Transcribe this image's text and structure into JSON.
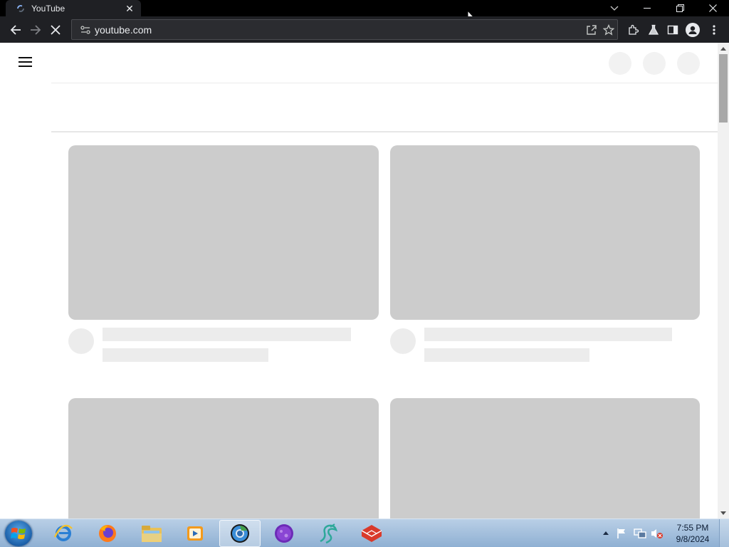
{
  "browser": {
    "tab": {
      "title": "YouTube",
      "favicon": "youtube-loading-icon",
      "close_icon": "close-icon"
    },
    "window_controls": [
      "tab-search-icon",
      "minimize-icon",
      "restore-icon",
      "close-icon"
    ],
    "toolbar": {
      "back_icon": "back-arrow-icon",
      "forward_icon": "forward-arrow-icon",
      "reload_icon": "stop-loading-icon",
      "address": "youtube.com",
      "site_info_icon": "tune-icon",
      "share_icon": "share-icon",
      "bookmark_icon": "star-icon",
      "extensions_icon": "puzzle-icon",
      "labs_icon": "flask-icon",
      "side_panel_icon": "side-panel-icon",
      "profile_icon": "profile-icon",
      "menu_icon": "kebab-menu-icon"
    }
  },
  "page": {
    "state": "loading-skeleton",
    "menu_icon": "hamburger-icon",
    "skeleton_colors": {
      "thumbnail": "#cccccc",
      "text": "#ececec",
      "header_circle": "#f2f2f2"
    },
    "video_grid_rows": 2,
    "video_grid_columns": 2
  },
  "taskbar": {
    "start_icon": "windows-start-icon",
    "apps": [
      {
        "name": "internet-explorer-icon",
        "active": false
      },
      {
        "name": "firefox-icon",
        "active": false
      },
      {
        "name": "file-explorer-icon",
        "active": false
      },
      {
        "name": "media-player-icon",
        "active": false
      },
      {
        "name": "chrome-icon",
        "active": true
      },
      {
        "name": "purple-app-icon",
        "active": false
      },
      {
        "name": "dragon-app-icon",
        "active": false
      },
      {
        "name": "red-app-icon",
        "active": false
      }
    ],
    "tray_icons": [
      "show-hidden-icons-arrow",
      "action-center-flag-icon",
      "network-icon",
      "volume-muted-icon"
    ],
    "clock": {
      "time": "7:55 PM",
      "date": "9/8/2024"
    }
  }
}
